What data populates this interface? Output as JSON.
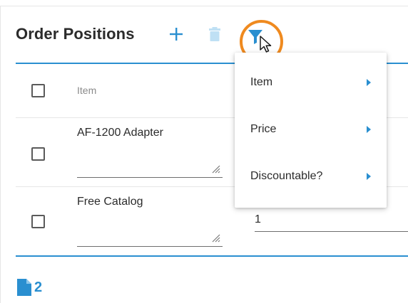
{
  "header": {
    "title": "Order Positions",
    "add_icon": "plus-icon",
    "delete_icon": "trash-icon",
    "filter_icon": "filter-icon"
  },
  "table": {
    "columns": [
      {
        "label": "Item"
      }
    ],
    "rows": [
      {
        "item": "AF-1200 Adapter",
        "quantity": ""
      },
      {
        "item": "Free Catalog",
        "quantity": "1"
      }
    ]
  },
  "filter_menu": {
    "items": [
      {
        "label": "Item"
      },
      {
        "label": "Price"
      },
      {
        "label": "Discountable?"
      }
    ]
  },
  "footer": {
    "icon": "document-icon",
    "count": "2"
  },
  "colors": {
    "accent": "#2a8fd0",
    "highlight": "#ef8a1f",
    "disabled_icon": "#bfe0f4"
  }
}
